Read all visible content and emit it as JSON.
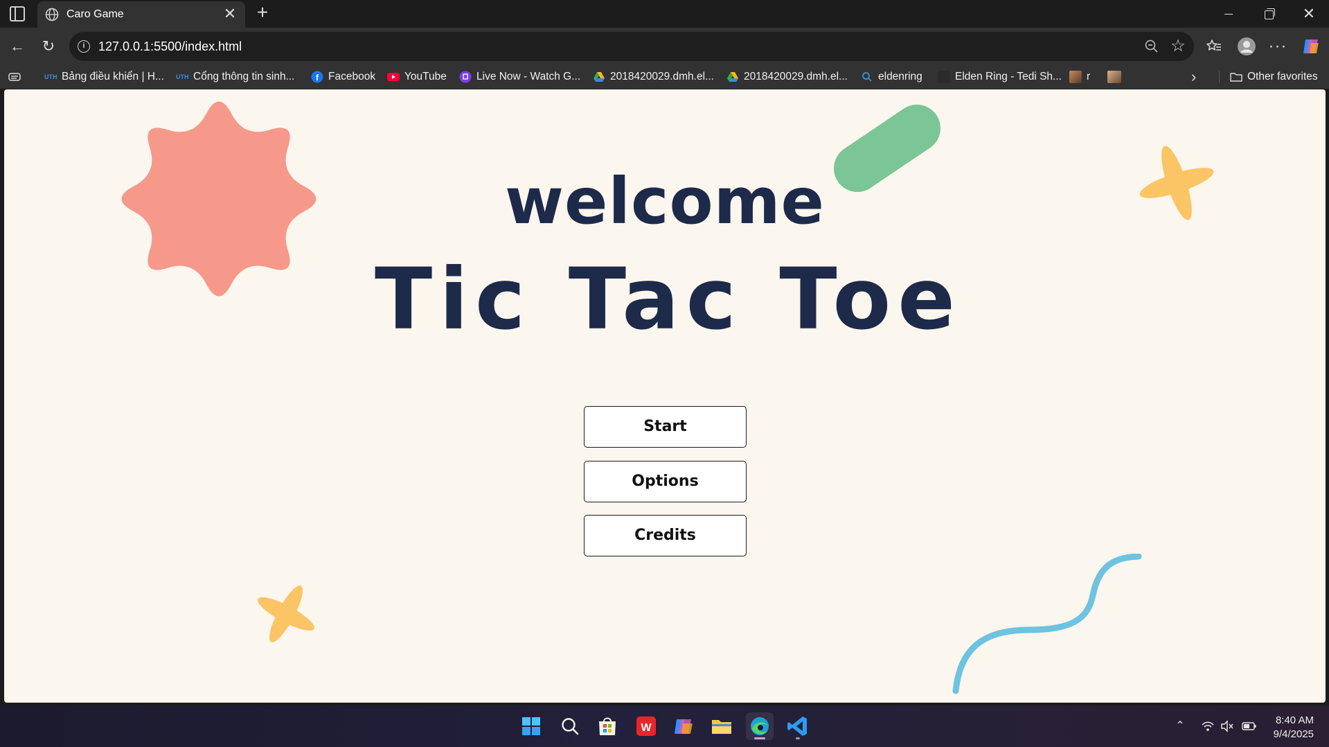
{
  "browser": {
    "tab": {
      "title": "Caro Game",
      "close_label": "✕"
    },
    "new_tab_label": "+",
    "url": "127.0.0.1:5500/index.html",
    "bookmarks": [
      {
        "label": "Bảng điều khiển | H...",
        "icon": "uth-icon"
      },
      {
        "label": "Cổng thông tin sinh...",
        "icon": "uth-icon"
      },
      {
        "label": "Facebook",
        "icon": "facebook-icon"
      },
      {
        "label": "YouTube",
        "icon": "youtube-icon"
      },
      {
        "label": "Live Now - Watch G...",
        "icon": "twitch-icon"
      },
      {
        "label": "2018420029.dmh.el...",
        "icon": "google-drive-icon"
      },
      {
        "label": "2018420029.dmh.el...",
        "icon": "google-drive-icon"
      },
      {
        "label": "eldenring",
        "icon": "search-icon"
      },
      {
        "label": "Elden Ring - Tedi Sh...",
        "icon": "video-icon"
      },
      {
        "label": "r",
        "icon": "image-icon"
      },
      {
        "label": "",
        "icon": "image-icon"
      }
    ],
    "other_favorites": "Other favorites"
  },
  "page": {
    "welcome": "welcome",
    "title": "Tic Tac Toe",
    "buttons": {
      "start": "Start",
      "options": "Options",
      "credits": "Credits"
    }
  },
  "colors": {
    "background": "#fbf6ee",
    "title": "#1e2a4a",
    "star": "#f6998b",
    "pill": "#7cc596",
    "sparkle": "#fbc565",
    "squiggle": "#6dc3e0"
  },
  "taskbar": {
    "apps": [
      "windows-start-icon",
      "search-icon",
      "microsoft-store-icon",
      "wps-office-icon",
      "copilot-icon",
      "file-explorer-icon",
      "edge-icon",
      "vscode-icon"
    ],
    "time": "8:40 AM",
    "date": "9/4/2025"
  }
}
